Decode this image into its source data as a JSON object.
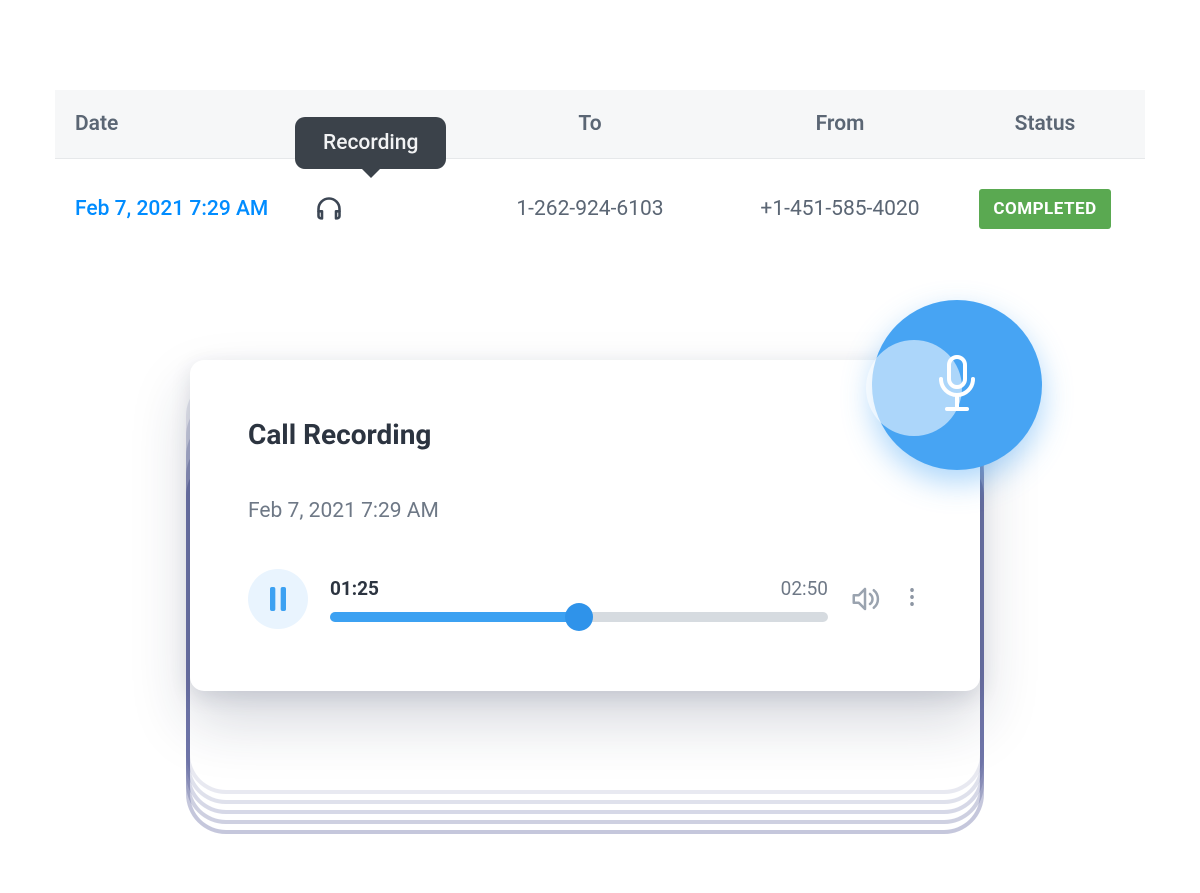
{
  "table": {
    "headers": {
      "date": "Date",
      "recording_tooltip": "Recording",
      "to": "To",
      "from": "From",
      "status": "Status"
    },
    "row": {
      "date": "Feb 7, 2021 7:29 AM",
      "to": "1-262-924-6103",
      "from": "+1-451-585-4020",
      "status": "COMPLETED"
    }
  },
  "player": {
    "title": "Call Recording",
    "subtitle": "Feb 7, 2021 7:29 AM",
    "current_time": "01:25",
    "total_time": "02:50",
    "progress_percent": 50
  },
  "colors": {
    "accent": "#3ca1f2",
    "status_ok": "#5aa951",
    "link": "#008cff"
  }
}
